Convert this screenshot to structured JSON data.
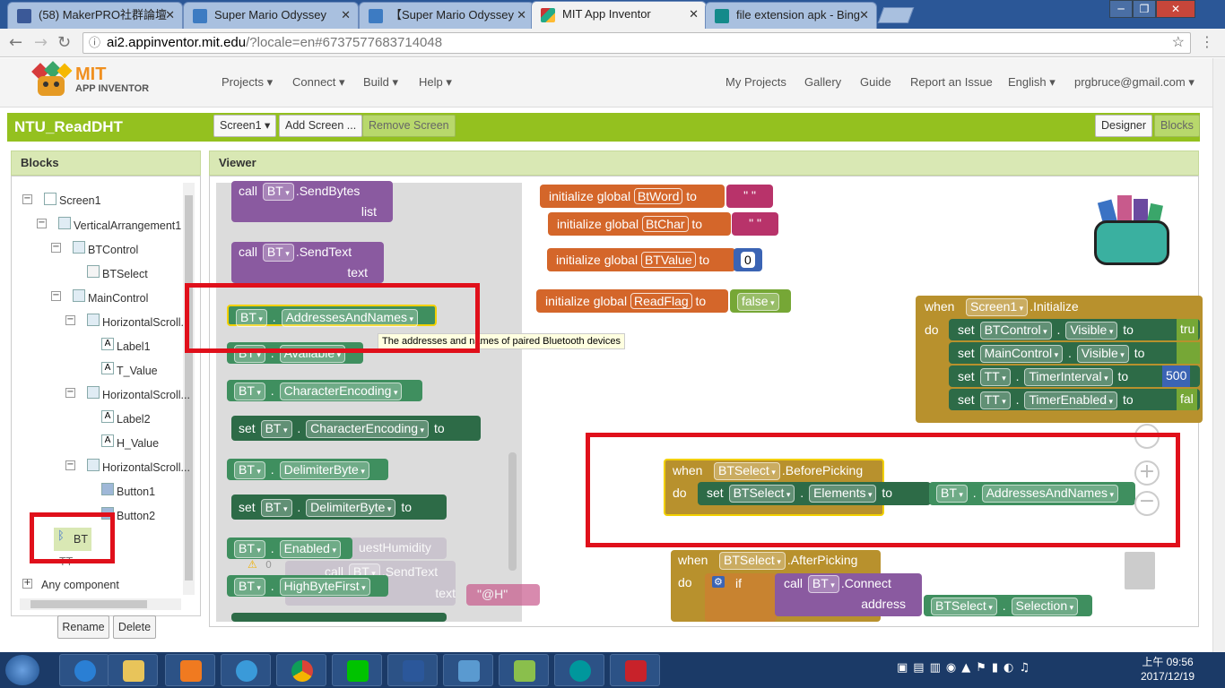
{
  "browser": {
    "tabs": [
      {
        "title": "(58) MakerPRO社群論壇",
        "icon": "facebook-icon"
      },
      {
        "title": "Super Mario Odyssey",
        "icon": "page-icon"
      },
      {
        "title": "【Super Mario Odyssey",
        "icon": "page-icon"
      },
      {
        "title": "MIT App Inventor",
        "icon": "appinventor-icon"
      },
      {
        "title": "file extension apk - Bing",
        "icon": "bing-icon"
      }
    ],
    "url_host": "ai2.appinventor.mit.edu",
    "url_rest": "/?locale=en#6737577683714048"
  },
  "header": {
    "logo_top": "MIT",
    "logo_bottom": "APP INVENTOR",
    "menus": [
      "Projects ▾",
      "Connect ▾",
      "Build ▾",
      "Help ▾"
    ],
    "right_links": [
      "My Projects",
      "Gallery",
      "Guide",
      "Report an Issue",
      "English ▾",
      "prgbruce@gmail.com ▾"
    ]
  },
  "project": {
    "name": "NTU_ReadDHT",
    "screen_select": "Screen1 ▾",
    "add_screen": "Add Screen ...",
    "remove_screen": "Remove Screen",
    "designer": "Designer",
    "blocks": "Blocks"
  },
  "blocks_panel": {
    "title": "Blocks",
    "tree": [
      "Screen1",
      "VerticalArrangement1",
      "BTControl",
      "BTSelect",
      "MainControl",
      "HorizontalScroll...",
      "Label1",
      "T_Value",
      "HorizontalScroll...",
      "Label2",
      "H_Value",
      "HorizontalScroll...",
      "Button1",
      "Button2",
      "BT",
      "TT",
      "Any component"
    ],
    "rename": "Rename",
    "delete": "Delete"
  },
  "viewer": {
    "title": "Viewer",
    "tooltip": "The addresses and names of paired Bluetooth devices",
    "flyout": {
      "call": "call",
      "bt": "BT",
      "sendbytes": ".SendBytes",
      "list": "list",
      "sendtext": ".SendText",
      "text": "text",
      "addresses": "AddressesAndNames",
      "available": "Available",
      "charenc": "CharacterEncoding",
      "set": "set",
      "to": "to",
      "delim": "DelimiterByte",
      "enabled": "Enabled",
      "highbyte": "HighByteFirst",
      "ghost_request": "uestHumidity",
      "ghost_text": "\"@H\"",
      "ghost_warn": "0"
    },
    "globals": [
      {
        "name": "BtWord",
        "value": "\" \""
      },
      {
        "name": "BtChar",
        "value": "\" \""
      },
      {
        "name": "BTValue",
        "value": "0"
      },
      {
        "name": "ReadFlag",
        "value": "false"
      }
    ],
    "init_global": "initialize global",
    "when": "when",
    "do": "do",
    "screen1": "Screen1",
    "initialize": ".Initialize",
    "init_sets": [
      {
        "comp": "BTControl",
        "prop": "Visible",
        "val": "tru"
      },
      {
        "comp": "MainControl",
        "prop": "Visible",
        "val": ""
      },
      {
        "comp": "TT",
        "prop": "TimerInterval",
        "val": "500"
      },
      {
        "comp": "TT",
        "prop": "TimerEnabled",
        "val": "fal"
      }
    ],
    "btselect": "BTSelect",
    "beforepicking": ".BeforePicking",
    "elements": "Elements",
    "afterpicking": ".AfterPicking",
    "if": "if",
    "connect": ".Connect",
    "address": "address",
    "selection": "Selection"
  },
  "taskbar": {
    "time": "上午 09:56",
    "date": "2017/12/19"
  }
}
